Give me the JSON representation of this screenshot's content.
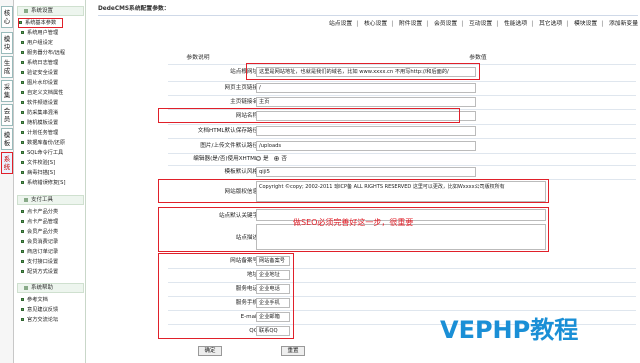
{
  "vtabs": [
    {
      "label": "核\n心",
      "active": false
    },
    {
      "label": "模\n块",
      "active": false
    },
    {
      "label": "生\n成",
      "active": false
    },
    {
      "label": "采\n集",
      "active": false
    },
    {
      "label": "会\n员",
      "active": false
    },
    {
      "label": "模\n板",
      "active": false
    },
    {
      "label": "系\n统",
      "active": true
    }
  ],
  "sidebar": {
    "sections": [
      {
        "title": "系统设置",
        "items": [
          "系统基本参数",
          "系统用户管理",
          "用户组设定",
          "服务器分布/远程",
          "系统日志管理",
          "验证安全设置",
          "图片水印设置",
          "自定义文档属性",
          "软件频道设置",
          "防采集串混淆",
          "随机模板设置",
          "计划任务管理",
          "数据库备份/还原",
          "SQL命令行工具",
          "文件校验[S]",
          "病毒扫描[S]",
          "系统错误修复[S]"
        ]
      },
      {
        "title": "支付工具",
        "items": [
          "点卡产品分类",
          "点卡产品管理",
          "会员产品分类",
          "会员消费记录",
          "商店订单记录",
          "支付接口设置",
          "配货方式设置"
        ]
      },
      {
        "title": "系统帮助",
        "items": [
          "参考文档",
          "意见建议反馈",
          "官方交流论坛"
        ]
      }
    ]
  },
  "main": {
    "title": "DedeCMS系统配置参数：",
    "tabs": [
      "站点设置",
      "核心设置",
      "附件设置",
      "会员设置",
      "互动设置",
      "性能选项",
      "其它选项",
      "模块设置",
      "添加新变量"
    ],
    "col_left": "参数说明",
    "col_right": "参数值",
    "rows": [
      {
        "label": "站点根网址:",
        "value": "这里是网站地址，也就是我们的域名，比如 www.xxxx.cn  不用写http://和后面的/"
      },
      {
        "label": "网页主页链接:",
        "value": "/"
      },
      {
        "label": "主页链接名:",
        "value": "主页"
      },
      {
        "label": "网站名称:",
        "value": ""
      },
      {
        "label": "文档HTML默认保存路径:",
        "value": ""
      },
      {
        "label": "图片/上传文件默认路径:",
        "value": "/uploads"
      },
      {
        "label": "编辑器(是/否)使用XHTML:",
        "yes": "是",
        "no": "否"
      },
      {
        "label": "模板默认风格:",
        "value": "qiji5"
      },
      {
        "label": "网站版权信息:",
        "value": "Copyright ©copy; 2002-2011 琼ICP备 ALL RIGHTS RESERVED   这里可以更改，比如Wxxxx公司版权所有"
      },
      {
        "label": "站点默认关键字:",
        "value": ""
      },
      {
        "label": "站点描述:",
        "value": ""
      },
      {
        "label": "网站备案号:",
        "value": "网站备案号"
      },
      {
        "label": "地址:",
        "value": "企业地址"
      },
      {
        "label": "服务电话:",
        "value": "企业电话"
      },
      {
        "label": "服务手机:",
        "value": "企业手机"
      },
      {
        "label": "E-mail:",
        "value": "企业邮箱"
      },
      {
        "label": "QQ:",
        "value": "联系QQ"
      }
    ],
    "seo_note": "做SEO必须完善好这一步，很重要",
    "btn_ok": "确定",
    "btn_reset": "重置"
  },
  "watermark": "VEPHP教程",
  "colors": {
    "highlight": "#e0202a",
    "watermark": "#1a8fd6"
  }
}
